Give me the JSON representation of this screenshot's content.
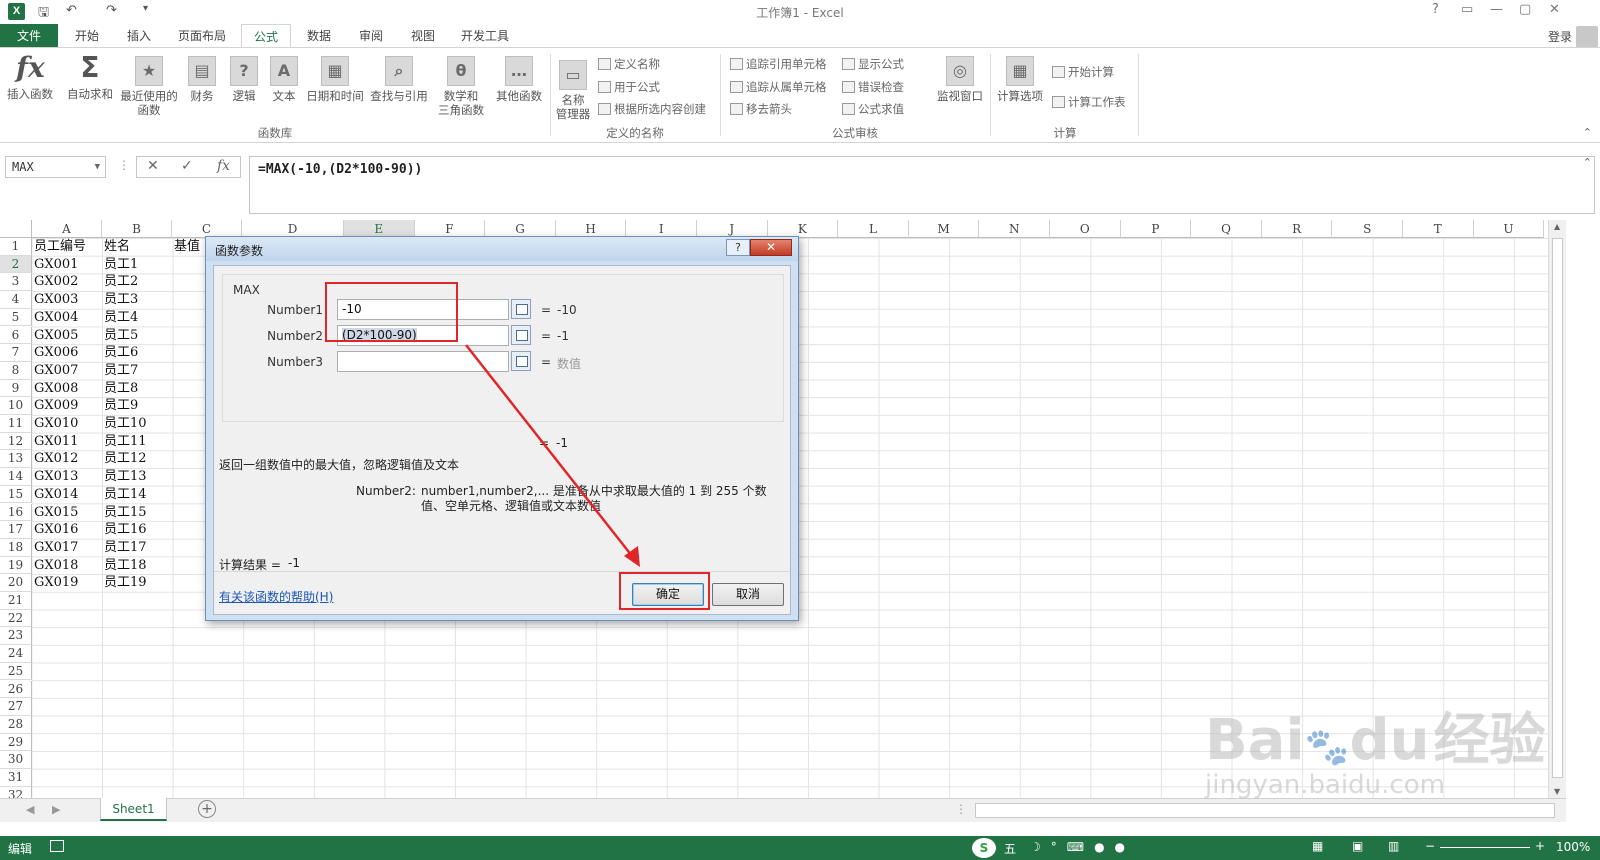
{
  "window": {
    "title": "工作簿1 - Excel",
    "logo": "X",
    "qat_icons": [
      "save-icon",
      "undo-icon",
      "redo-icon",
      "customize-icon"
    ],
    "controls": [
      "?",
      "▭",
      "—",
      "▢",
      "✕"
    ]
  },
  "tabs": [
    "文件",
    "开始",
    "插入",
    "页面布局",
    "公式",
    "数据",
    "审阅",
    "视图",
    "开发工具"
  ],
  "active_tab": "公式",
  "login": "登录",
  "ribbon": {
    "insert_function": "插入函数",
    "autosum": "自动求和",
    "recent": "最近使用的\n函数",
    "financial": "财务",
    "logical": "逻辑",
    "text": "文本",
    "datetime": "日期和时间",
    "lookup": "查找与引用",
    "math": "数学和\n三角函数",
    "other": "其他函数",
    "group_library": "函数库",
    "name_manager": "名称\n管理器",
    "define_name": "定义名称",
    "use_in_formula": "用于公式",
    "create_from_selection": "根据所选内容创建",
    "group_names": "定义的名称",
    "trace_precedents": "追踪引用单元格",
    "trace_dependents": "追踪从属单元格",
    "remove_arrows": "移去箭头",
    "show_formulas": "显示公式",
    "error_checking": "错误检查",
    "evaluate_formula": "公式求值",
    "watch_window": "监视窗口",
    "group_audit": "公式审核",
    "calc_options": "计算选项",
    "calc_now": "开始计算",
    "calc_sheet": "计算工作表",
    "group_calc": "计算"
  },
  "formula_bar": {
    "name_box": "MAX",
    "formula": "=MAX(-10,(D2*100-90))",
    "cancel_symbol": "✕",
    "enter_symbol": "✓",
    "fx_symbol": "fx"
  },
  "columns": [
    "A",
    "B",
    "C",
    "D",
    "E",
    "F",
    "G",
    "H",
    "I",
    "J",
    "K",
    "L",
    "M",
    "N",
    "O",
    "P",
    "Q",
    "R",
    "S",
    "T",
    "U"
  ],
  "rows": [
    "1",
    "2",
    "3",
    "4",
    "5",
    "6",
    "7",
    "8",
    "9",
    "10",
    "11",
    "12",
    "13",
    "14",
    "15",
    "16",
    "17",
    "18",
    "19",
    "20",
    "21",
    "22",
    "23",
    "24",
    "25",
    "26",
    "27",
    "28",
    "29",
    "30",
    "31",
    "32"
  ],
  "header_row": {
    "a": "员工编号",
    "b": "姓名",
    "c": "基值"
  },
  "table_rows": [
    [
      "GX001",
      "员工1"
    ],
    [
      "GX002",
      "员工2"
    ],
    [
      "GX003",
      "员工3"
    ],
    [
      "GX004",
      "员工4"
    ],
    [
      "GX005",
      "员工5"
    ],
    [
      "GX006",
      "员工6"
    ],
    [
      "GX007",
      "员工7"
    ],
    [
      "GX008",
      "员工8"
    ],
    [
      "GX009",
      "员工9"
    ],
    [
      "GX010",
      "员工10"
    ],
    [
      "GX011",
      "员工11"
    ],
    [
      "GX012",
      "员工12"
    ],
    [
      "GX013",
      "员工13"
    ],
    [
      "GX014",
      "员工14"
    ],
    [
      "GX015",
      "员工15"
    ],
    [
      "GX016",
      "员工16"
    ],
    [
      "GX017",
      "员工17"
    ],
    [
      "GX018",
      "员工18"
    ],
    [
      "GX019",
      "员工19"
    ]
  ],
  "sheet_tab": "Sheet1",
  "status": {
    "mode": "编辑",
    "zoom": "100%",
    "ime": "五"
  },
  "dialog": {
    "title": "函数参数",
    "help_btn": "?",
    "close_btn": "✕",
    "function": "MAX",
    "args": [
      {
        "label": "Number1",
        "value": "-10",
        "result": "-10"
      },
      {
        "label": "Number2",
        "value": "(D2*100-90)",
        "result": "-1"
      },
      {
        "label": "Number3",
        "value": "",
        "result": "数值"
      }
    ],
    "eq": "=",
    "formula_result_inline": "-1",
    "description": "返回一组数值中的最大值，忽略逻辑值及文本",
    "arg_help_label": "Number2:",
    "arg_help_text": "number1,number2,... 是准备从中求取最大值的 1 到 255 个数值、空单元格、逻辑值或文本数值",
    "result_label": "计算结果 =",
    "result_value": "-1",
    "help_link": "有关该函数的帮助(H)",
    "ok": "确定",
    "cancel": "取消"
  },
  "watermark": {
    "brand": "Bai",
    "brand2": "du",
    "cn": "经验",
    "url": "jingyan.baidu.com"
  },
  "colors": {
    "excel_green": "#217346",
    "annotation_red": "#e0262a"
  }
}
